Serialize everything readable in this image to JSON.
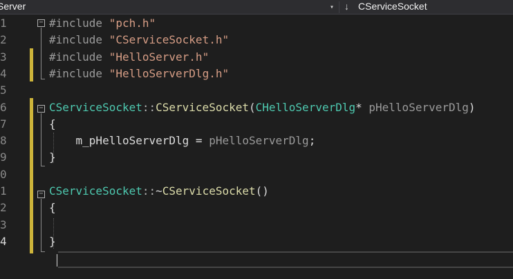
{
  "nav": {
    "project": "Server",
    "member": "CServiceSocket"
  },
  "lines": [
    {
      "n": "1",
      "parts": [
        {
          "t": "#include ",
          "c": "kw-inc"
        },
        {
          "t": "\"pch.h\"",
          "c": "str"
        }
      ]
    },
    {
      "n": "2",
      "parts": [
        {
          "t": "#include ",
          "c": "kw-inc"
        },
        {
          "t": "\"CServiceSocket.h\"",
          "c": "str"
        }
      ]
    },
    {
      "n": "3",
      "parts": [
        {
          "t": "#include ",
          "c": "kw-inc"
        },
        {
          "t": "\"HelloServer.h\"",
          "c": "str"
        }
      ]
    },
    {
      "n": "4",
      "parts": [
        {
          "t": "#include ",
          "c": "kw-inc"
        },
        {
          "t": "\"HelloServerDlg.h\"",
          "c": "str"
        }
      ]
    },
    {
      "n": "5",
      "parts": []
    },
    {
      "n": "6",
      "parts": [
        {
          "t": "CServiceSocket",
          "c": "type"
        },
        {
          "t": "::",
          "c": "punct"
        },
        {
          "t": "CServiceSocket",
          "c": "func"
        },
        {
          "t": "(",
          "c": "plain"
        },
        {
          "t": "CHelloServerDlg",
          "c": "type"
        },
        {
          "t": "* ",
          "c": "plain"
        },
        {
          "t": "pHelloServerDlg",
          "c": "param"
        },
        {
          "t": ")",
          "c": "plain"
        }
      ]
    },
    {
      "n": "7",
      "parts": [
        {
          "t": "{",
          "c": "plain"
        }
      ]
    },
    {
      "n": "8",
      "parts": [
        {
          "t": "    m_pHelloServerDlg ",
          "c": "field"
        },
        {
          "t": "= ",
          "c": "plain"
        },
        {
          "t": "pHelloServerDlg",
          "c": "param"
        },
        {
          "t": ";",
          "c": "plain"
        }
      ]
    },
    {
      "n": "9",
      "parts": [
        {
          "t": "}",
          "c": "plain"
        }
      ]
    },
    {
      "n": "0",
      "parts": []
    },
    {
      "n": "1",
      "parts": [
        {
          "t": "CServiceSocket",
          "c": "type"
        },
        {
          "t": "::",
          "c": "punct"
        },
        {
          "t": "~",
          "c": "plain"
        },
        {
          "t": "CServiceSocket",
          "c": "func"
        },
        {
          "t": "()",
          "c": "plain"
        }
      ]
    },
    {
      "n": "2",
      "parts": [
        {
          "t": "{",
          "c": "plain"
        }
      ]
    },
    {
      "n": "3",
      "parts": []
    },
    {
      "n": "4",
      "parts": [
        {
          "t": "}",
          "c": "plain"
        }
      ]
    }
  ]
}
